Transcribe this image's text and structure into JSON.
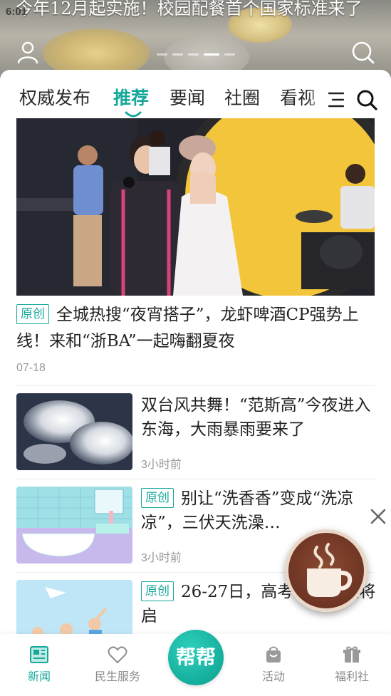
{
  "status_bar": {
    "time": "6:01"
  },
  "hero": {
    "title": "今年12月起实施！校园配餐首个国家标准来了",
    "dots_count": 5,
    "active_dot": 4,
    "user_icon": "user-icon",
    "search_icon": "search-icon"
  },
  "tabs": {
    "items": [
      {
        "label": "权威发布",
        "active": false
      },
      {
        "label": "推荐",
        "active": true
      },
      {
        "label": "要闻",
        "active": false
      },
      {
        "label": "社圈",
        "active": false
      },
      {
        "label": "看视",
        "active": false
      }
    ],
    "menu_icon": "menu-icon",
    "search_icon": "search-icon"
  },
  "feature": {
    "badge": "原创",
    "title": "全城热搜“夜宵搭子”，龙虾啤酒CP强势上线！来和“浙BA”一起嗨翻夏夜",
    "date": "07-18"
  },
  "articles": [
    {
      "badge": "",
      "title": "双台风共舞！“范斯高”今夜进入东海，大雨暴雨要来了",
      "time": "3小时前"
    },
    {
      "badge": "原创",
      "title": "别让“洗香香”变成“洗凉凉”，三伏天洗澡…",
      "time": "3小时前"
    },
    {
      "badge": "原创",
      "title": "26-27日，高考志愿填报将启",
      "time": ""
    }
  ],
  "floating": {
    "close_icon": "close-icon",
    "icon": "coffee-cup-icon"
  },
  "bottom_nav": {
    "items": [
      {
        "label": "新闻",
        "icon": "newspaper-icon",
        "active": true
      },
      {
        "label": "民生服务",
        "icon": "heart-icon",
        "active": false
      },
      {
        "label": "帮帮",
        "icon": "bangbang-icon",
        "active": false
      },
      {
        "label": "活动",
        "icon": "shopping-bag-icon",
        "active": false
      },
      {
        "label": "福利社",
        "icon": "gift-icon",
        "active": false
      }
    ]
  },
  "colors": {
    "accent": "#16a89a",
    "text": "#222222",
    "muted": "#999999"
  }
}
